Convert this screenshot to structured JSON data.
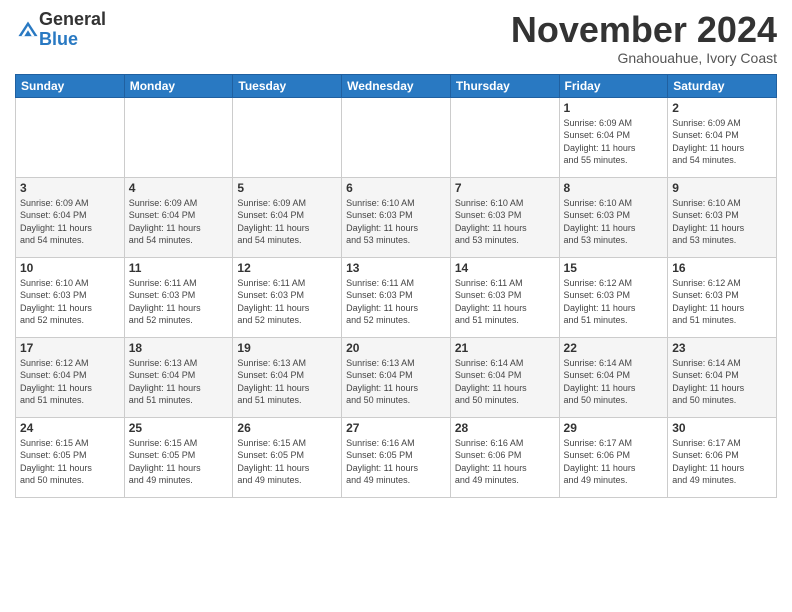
{
  "logo": {
    "general": "General",
    "blue": "Blue"
  },
  "header": {
    "month": "November 2024",
    "location": "Gnahouahue, Ivory Coast"
  },
  "weekdays": [
    "Sunday",
    "Monday",
    "Tuesday",
    "Wednesday",
    "Thursday",
    "Friday",
    "Saturday"
  ],
  "weeks": [
    [
      {
        "day": "",
        "info": ""
      },
      {
        "day": "",
        "info": ""
      },
      {
        "day": "",
        "info": ""
      },
      {
        "day": "",
        "info": ""
      },
      {
        "day": "",
        "info": ""
      },
      {
        "day": "1",
        "info": "Sunrise: 6:09 AM\nSunset: 6:04 PM\nDaylight: 11 hours\nand 55 minutes."
      },
      {
        "day": "2",
        "info": "Sunrise: 6:09 AM\nSunset: 6:04 PM\nDaylight: 11 hours\nand 54 minutes."
      }
    ],
    [
      {
        "day": "3",
        "info": "Sunrise: 6:09 AM\nSunset: 6:04 PM\nDaylight: 11 hours\nand 54 minutes."
      },
      {
        "day": "4",
        "info": "Sunrise: 6:09 AM\nSunset: 6:04 PM\nDaylight: 11 hours\nand 54 minutes."
      },
      {
        "day": "5",
        "info": "Sunrise: 6:09 AM\nSunset: 6:04 PM\nDaylight: 11 hours\nand 54 minutes."
      },
      {
        "day": "6",
        "info": "Sunrise: 6:10 AM\nSunset: 6:03 PM\nDaylight: 11 hours\nand 53 minutes."
      },
      {
        "day": "7",
        "info": "Sunrise: 6:10 AM\nSunset: 6:03 PM\nDaylight: 11 hours\nand 53 minutes."
      },
      {
        "day": "8",
        "info": "Sunrise: 6:10 AM\nSunset: 6:03 PM\nDaylight: 11 hours\nand 53 minutes."
      },
      {
        "day": "9",
        "info": "Sunrise: 6:10 AM\nSunset: 6:03 PM\nDaylight: 11 hours\nand 53 minutes."
      }
    ],
    [
      {
        "day": "10",
        "info": "Sunrise: 6:10 AM\nSunset: 6:03 PM\nDaylight: 11 hours\nand 52 minutes."
      },
      {
        "day": "11",
        "info": "Sunrise: 6:11 AM\nSunset: 6:03 PM\nDaylight: 11 hours\nand 52 minutes."
      },
      {
        "day": "12",
        "info": "Sunrise: 6:11 AM\nSunset: 6:03 PM\nDaylight: 11 hours\nand 52 minutes."
      },
      {
        "day": "13",
        "info": "Sunrise: 6:11 AM\nSunset: 6:03 PM\nDaylight: 11 hours\nand 52 minutes."
      },
      {
        "day": "14",
        "info": "Sunrise: 6:11 AM\nSunset: 6:03 PM\nDaylight: 11 hours\nand 51 minutes."
      },
      {
        "day": "15",
        "info": "Sunrise: 6:12 AM\nSunset: 6:03 PM\nDaylight: 11 hours\nand 51 minutes."
      },
      {
        "day": "16",
        "info": "Sunrise: 6:12 AM\nSunset: 6:03 PM\nDaylight: 11 hours\nand 51 minutes."
      }
    ],
    [
      {
        "day": "17",
        "info": "Sunrise: 6:12 AM\nSunset: 6:04 PM\nDaylight: 11 hours\nand 51 minutes."
      },
      {
        "day": "18",
        "info": "Sunrise: 6:13 AM\nSunset: 6:04 PM\nDaylight: 11 hours\nand 51 minutes."
      },
      {
        "day": "19",
        "info": "Sunrise: 6:13 AM\nSunset: 6:04 PM\nDaylight: 11 hours\nand 51 minutes."
      },
      {
        "day": "20",
        "info": "Sunrise: 6:13 AM\nSunset: 6:04 PM\nDaylight: 11 hours\nand 50 minutes."
      },
      {
        "day": "21",
        "info": "Sunrise: 6:14 AM\nSunset: 6:04 PM\nDaylight: 11 hours\nand 50 minutes."
      },
      {
        "day": "22",
        "info": "Sunrise: 6:14 AM\nSunset: 6:04 PM\nDaylight: 11 hours\nand 50 minutes."
      },
      {
        "day": "23",
        "info": "Sunrise: 6:14 AM\nSunset: 6:04 PM\nDaylight: 11 hours\nand 50 minutes."
      }
    ],
    [
      {
        "day": "24",
        "info": "Sunrise: 6:15 AM\nSunset: 6:05 PM\nDaylight: 11 hours\nand 50 minutes."
      },
      {
        "day": "25",
        "info": "Sunrise: 6:15 AM\nSunset: 6:05 PM\nDaylight: 11 hours\nand 49 minutes."
      },
      {
        "day": "26",
        "info": "Sunrise: 6:15 AM\nSunset: 6:05 PM\nDaylight: 11 hours\nand 49 minutes."
      },
      {
        "day": "27",
        "info": "Sunrise: 6:16 AM\nSunset: 6:05 PM\nDaylight: 11 hours\nand 49 minutes."
      },
      {
        "day": "28",
        "info": "Sunrise: 6:16 AM\nSunset: 6:06 PM\nDaylight: 11 hours\nand 49 minutes."
      },
      {
        "day": "29",
        "info": "Sunrise: 6:17 AM\nSunset: 6:06 PM\nDaylight: 11 hours\nand 49 minutes."
      },
      {
        "day": "30",
        "info": "Sunrise: 6:17 AM\nSunset: 6:06 PM\nDaylight: 11 hours\nand 49 minutes."
      }
    ]
  ]
}
